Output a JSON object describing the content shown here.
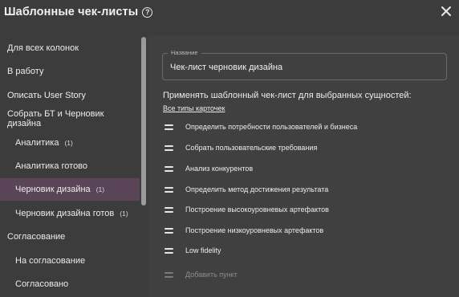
{
  "dialog": {
    "title": "Шаблонные чек-листы",
    "help_icon": "?"
  },
  "sidebar": {
    "items": [
      {
        "label": "Для всех колонок",
        "level": 0
      },
      {
        "label": "В работу",
        "level": 0
      },
      {
        "label": "Описать User Story",
        "level": 0
      },
      {
        "label": "Собрать БТ и Черновик дизайна",
        "level": 0
      },
      {
        "label": "Аналитика",
        "count": "(1)",
        "level": 1
      },
      {
        "label": "Аналитика готово",
        "level": 1
      },
      {
        "label": "Черновик дизайна",
        "count": "(1)",
        "level": 1,
        "selected": true
      },
      {
        "label": "Черновик дизайна готов",
        "count": "(1)",
        "level": 1
      },
      {
        "label": "Согласование",
        "level": 0
      },
      {
        "label": "На согласование",
        "level": 1
      },
      {
        "label": "Согласовано",
        "level": 1
      }
    ]
  },
  "main": {
    "name_label": "Название",
    "name_value": "Чек-лист черновик дизайна",
    "apply_text": "Применять шаблонный чек-лист для выбранных сущностей:",
    "types_link": "Все типы карточек",
    "checklist": [
      "Определить потребности пользователей и бизнеса",
      "Собрать пользовательские требования",
      "Анализ конкурентов",
      "Определить метод достижения результата",
      "Построение высокоуровневых артефактов",
      "Построение низкоуровневых артефактов",
      "Low fidelity"
    ],
    "add_item": "Добавить пункт"
  },
  "colors": {
    "background": "#3c3c3c",
    "selected": "#5a4558",
    "text": "#ececec"
  }
}
